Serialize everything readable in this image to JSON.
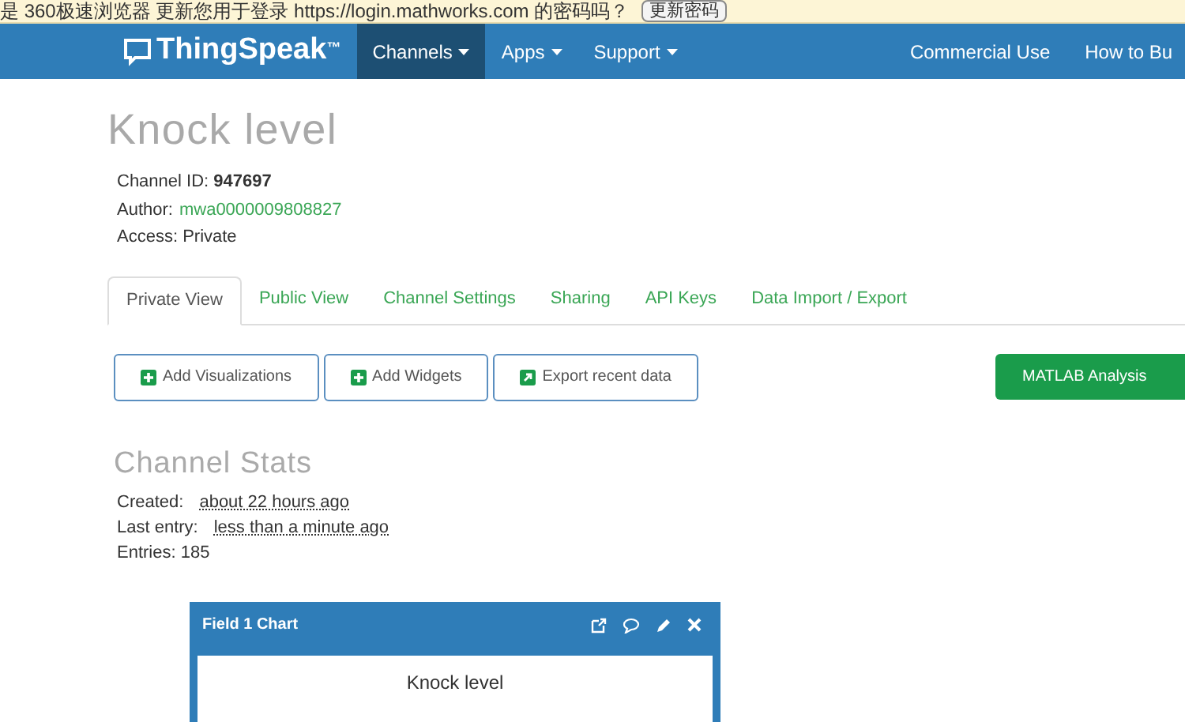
{
  "browser_prompt": {
    "text": "是 360极速浏览器 更新您用于登录 https://login.mathworks.com 的密码吗？",
    "button": "更新密码"
  },
  "navbar": {
    "brand": "ThingSpeak",
    "trademark": "™",
    "items": [
      {
        "label": "Channels",
        "selected": true
      },
      {
        "label": "Apps",
        "selected": false
      },
      {
        "label": "Support",
        "selected": false
      }
    ],
    "right_items": [
      "Commercial Use",
      "How to Bu"
    ]
  },
  "channel": {
    "title": "Knock level",
    "id_label": "Channel ID:",
    "id": "947697",
    "author_label": "Author:",
    "author": "mwa0000009808827",
    "access": "Access: Private"
  },
  "tabs": [
    {
      "label": "Private View",
      "selected": true
    },
    {
      "label": "Public View",
      "selected": false
    },
    {
      "label": "Channel Settings",
      "selected": false
    },
    {
      "label": "Sharing",
      "selected": false
    },
    {
      "label": "API Keys",
      "selected": false
    },
    {
      "label": "Data Import / Export",
      "selected": false
    }
  ],
  "actions": [
    {
      "label": "Add Visualizations",
      "kind": "add"
    },
    {
      "label": "Add Widgets",
      "kind": "add"
    },
    {
      "label": "Export recent data",
      "kind": "export"
    }
  ],
  "matlab_button": "MATLAB Analysis",
  "stats": {
    "title": "Channel Stats",
    "created_label": "Created:",
    "created": "about 22 hours ago",
    "last_label": "Last entry:",
    "last": "less than a minute ago",
    "entries": "Entries: 185"
  },
  "chart_panel": {
    "title": "Field 1 Chart",
    "chart_title": "Knock level"
  }
}
